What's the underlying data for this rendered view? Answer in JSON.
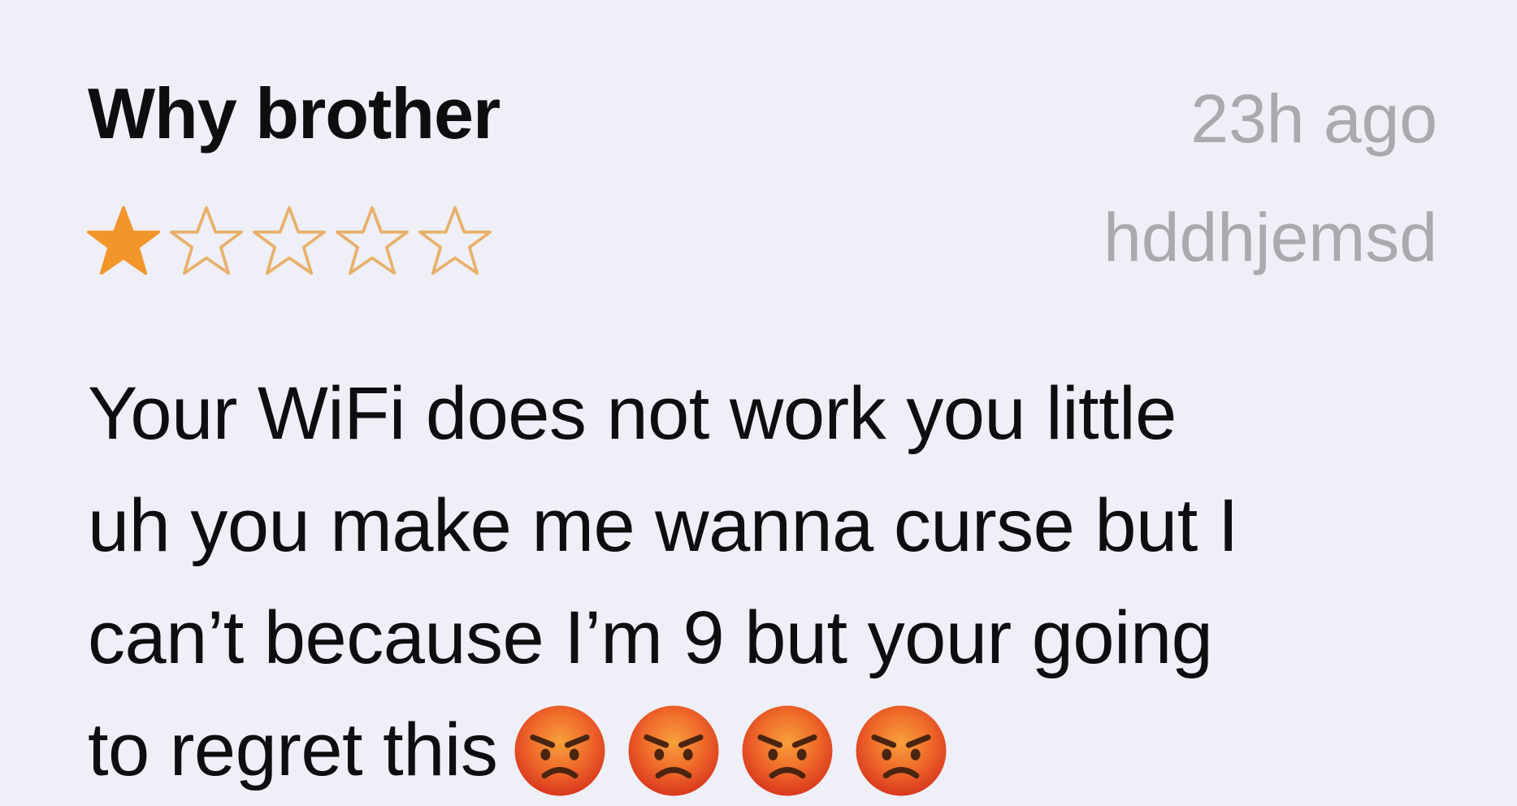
{
  "review": {
    "title": "Why brother",
    "date": "23h ago",
    "author": "hddhjemsd",
    "rating": 1,
    "max_rating": 5,
    "body_lines": [
      "Your WiFi does not work you little",
      "uh you make me wanna curse but I",
      "can’t because I’m 9 but your going",
      "to regret this"
    ],
    "emojis": [
      "angry-face-icon",
      "angry-face-icon",
      "angry-face-icon",
      "angry-face-icon"
    ]
  },
  "colors": {
    "background": "#eeeff7",
    "star_filled": "#f2952a",
    "star_outline": "#e8b06a",
    "meta_text": "#a9a9ae"
  }
}
